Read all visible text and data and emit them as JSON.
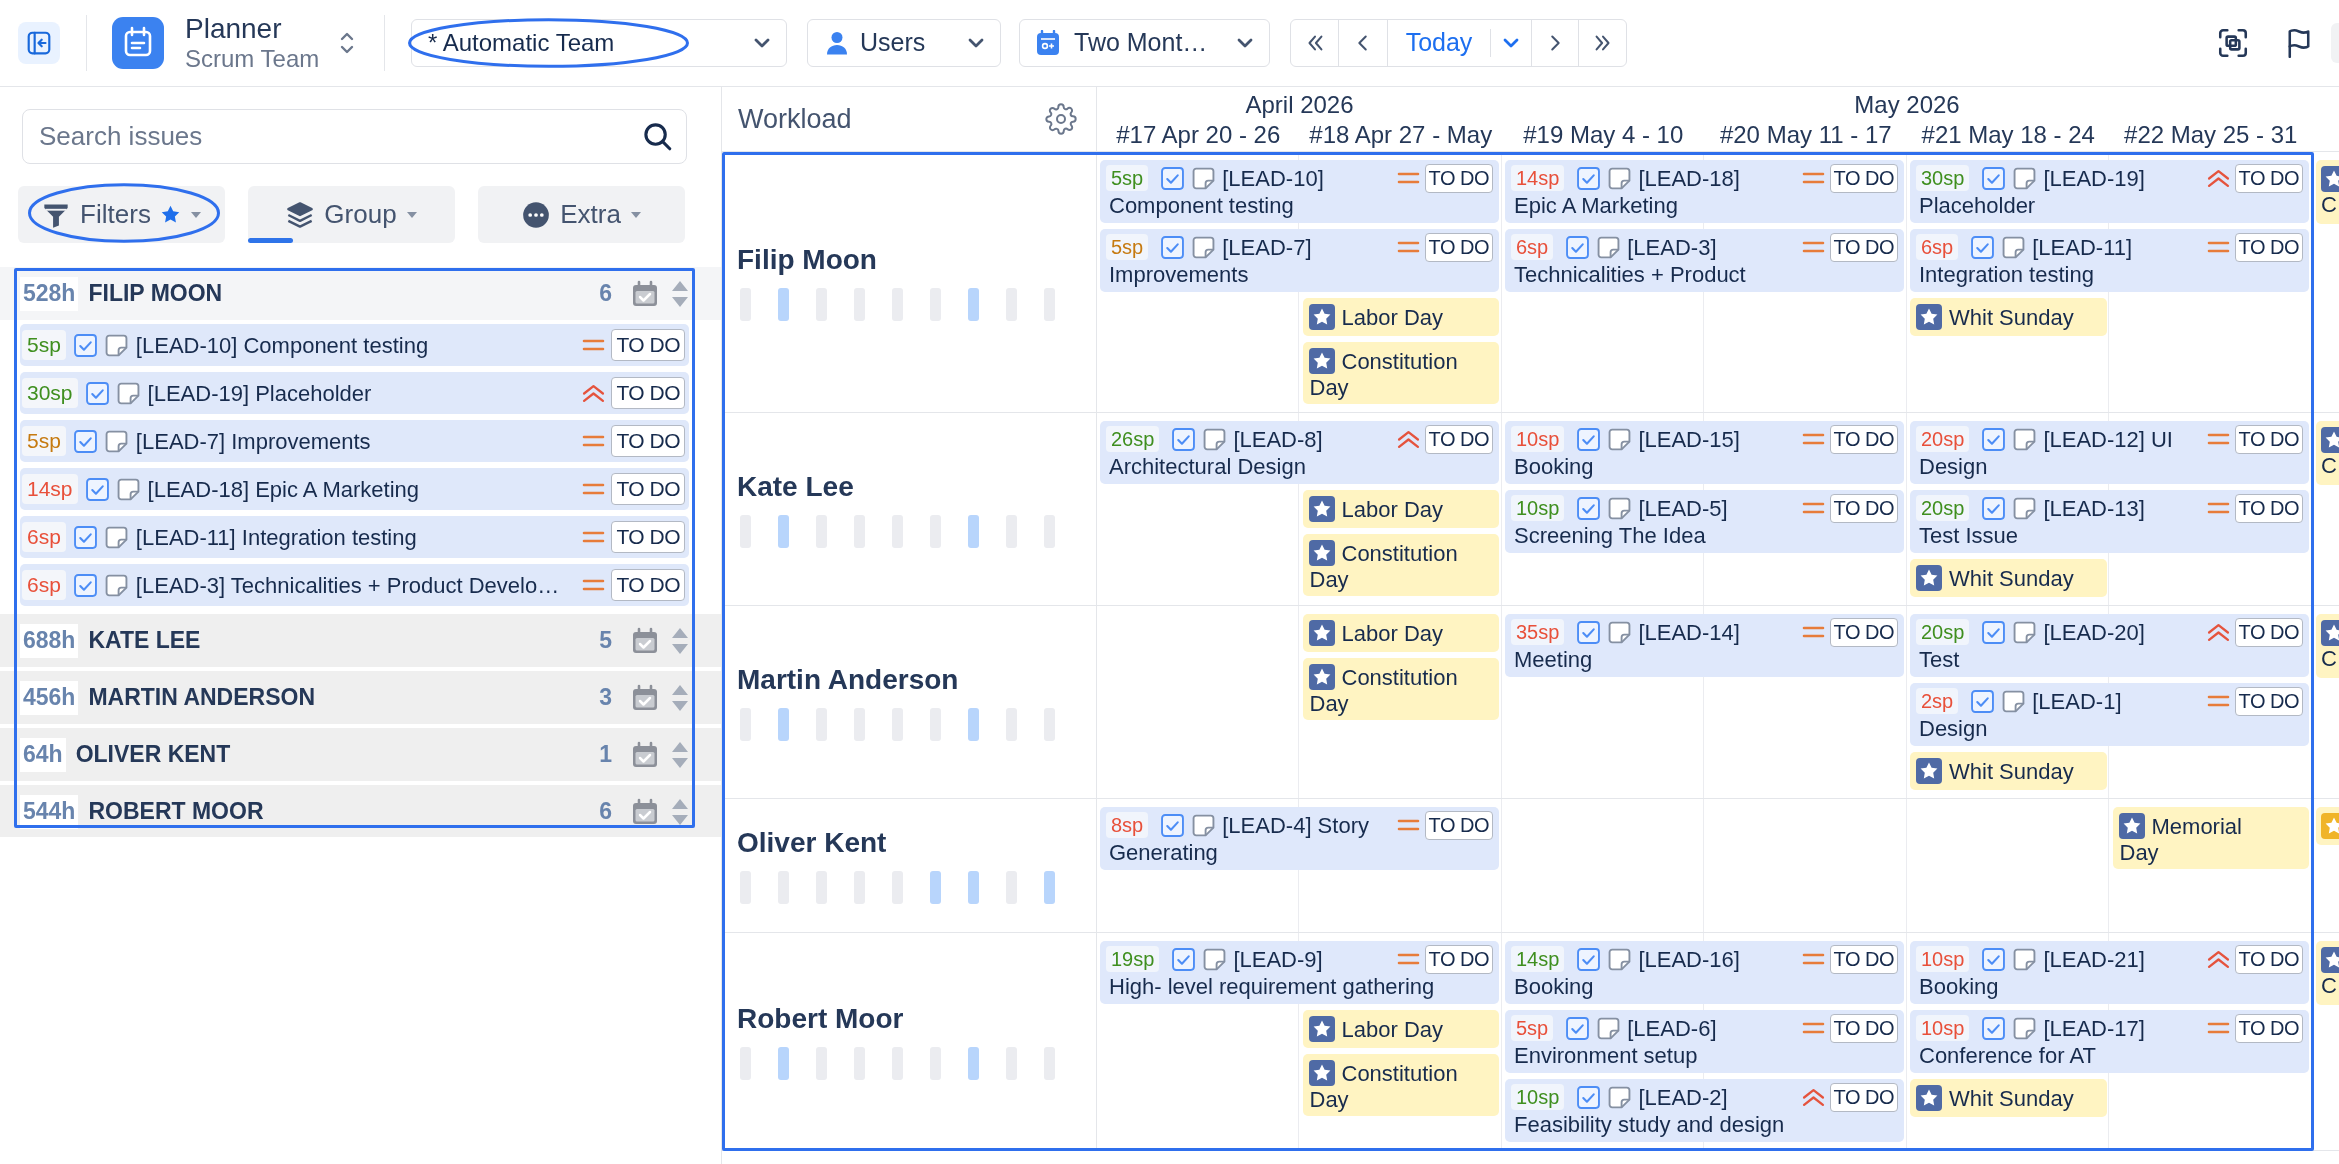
{
  "toolbar": {
    "app": {
      "title": "Planner",
      "subtitle": "Scrum Team"
    },
    "team_select": {
      "value": "* Automatic Team",
      "highlighted": true
    },
    "users_select": {
      "value": "Users"
    },
    "range_select": {
      "value": "Two Mont…"
    },
    "today": "Today"
  },
  "sidebar": {
    "search": {
      "placeholder": "Search issues"
    },
    "tabs": [
      {
        "label": "Filters",
        "selected": false,
        "starred": true,
        "highlighted": true
      },
      {
        "label": "Group",
        "selected": true,
        "starred": false,
        "highlighted": false
      },
      {
        "label": "Extra",
        "selected": false,
        "starred": false,
        "highlighted": false
      }
    ],
    "list": {
      "highlighted": true,
      "groups": [
        {
          "hours": "528h",
          "name": "FILIP MOON",
          "count": "6",
          "issues": [
            {
              "points": "5sp",
              "color": "#3f8f1f",
              "text": "[LEAD-10] Component testing",
              "kind": "medium",
              "status": "TO DO"
            },
            {
              "points": "30sp",
              "color": "#3f8f1f",
              "text": "[LEAD-19] Placeholder",
              "kind": "high",
              "status": "TO DO"
            },
            {
              "points": "5sp",
              "color": "#c67a10",
              "text": "[LEAD-7] Improvements",
              "kind": "medium",
              "status": "TO DO"
            },
            {
              "points": "14sp",
              "color": "#e8503a",
              "text": "[LEAD-18] Epic A Marketing",
              "kind": "medium",
              "status": "TO DO"
            },
            {
              "points": "6sp",
              "color": "#e8503a",
              "text": "[LEAD-11] Integration testing",
              "kind": "medium",
              "status": "TO DO"
            },
            {
              "points": "6sp",
              "color": "#e8503a",
              "text": "[LEAD-3] Technicalities + Product Develo…",
              "kind": "medium",
              "status": "TO DO"
            }
          ]
        },
        {
          "hours": "688h",
          "name": "KATE LEE",
          "count": "5"
        },
        {
          "hours": "456h",
          "name": "MARTIN ANDERSON",
          "count": "3"
        },
        {
          "hours": "64h",
          "name": "OLIVER KENT",
          "count": "1"
        },
        {
          "hours": "544h",
          "name": "ROBERT MOOR",
          "count": "6"
        }
      ]
    }
  },
  "workload": {
    "title": "Workload",
    "highlighted": true,
    "months": [
      {
        "label": "April 2026",
        "weeks": [
          "#17 Apr 20 - 26",
          "#18 Apr 27 - May"
        ]
      },
      {
        "label": "May 2026",
        "weeks": [
          "#19 May 4 - 10",
          "#20 May 11 - 17",
          "#21 May 18 - 24",
          "#22 May 25 - 31"
        ]
      }
    ],
    "people": [
      {
        "name": "Filip Moon",
        "load": [
          {
            "on": false
          },
          {
            "on": true
          },
          {
            "on": false
          },
          {
            "on": false
          },
          {
            "on": false
          },
          {
            "on": false
          },
          {
            "on": true
          },
          {
            "on": false
          },
          {
            "on": false
          }
        ],
        "sprint_1": {
          "issues": [
            {
              "points": "5sp",
              "color": "#3f8f1f",
              "lines": [
                "[LEAD-10]",
                "Component testing"
              ],
              "kind": "medium",
              "status": "TO DO"
            },
            {
              "points": "5sp",
              "color": "#c67a10",
              "lines": [
                "[LEAD-7]",
                "Improvements"
              ],
              "kind": "medium",
              "status": "TO DO"
            }
          ],
          "second_week_holidays": [
            {
              "lines": [
                "Labor Day"
              ],
              "color": "#4f6aa5"
            },
            {
              "lines": [
                "Constitution",
                "Day"
              ],
              "color": "#4f6aa5"
            }
          ]
        },
        "sprint_2": {
          "issues": [
            {
              "points": "14sp",
              "color": "#e8503a",
              "lines": [
                "[LEAD-18]",
                "Epic A Marketing"
              ],
              "kind": "medium",
              "status": "TO DO"
            },
            {
              "points": "6sp",
              "color": "#e8503a",
              "lines": [
                "[LEAD-3]",
                "Technicalities + Product"
              ],
              "kind": "medium",
              "status": "TO DO"
            }
          ]
        },
        "sprint_3": {
          "issues": [
            {
              "points": "30sp",
              "color": "#3f8f1f",
              "lines": [
                "[LEAD-19]",
                "Placeholder"
              ],
              "kind": "high",
              "status": "TO DO"
            },
            {
              "points": "6sp",
              "color": "#e8503a",
              "lines": [
                "[LEAD-11]",
                "Integration testing"
              ],
              "kind": "medium",
              "status": "TO DO"
            }
          ],
          "first_week_holidays": [
            {
              "lines": [
                "Whit Sunday"
              ],
              "color": "#4f6aa5"
            }
          ]
        },
        "cut_off": [
          {
            "text": "C",
            "color": "#4f6aa5"
          }
        ]
      },
      {
        "name": "Kate Lee",
        "load": [
          {
            "on": false
          },
          {
            "on": true
          },
          {
            "on": false
          },
          {
            "on": false
          },
          {
            "on": false
          },
          {
            "on": false
          },
          {
            "on": true
          },
          {
            "on": false
          },
          {
            "on": false
          }
        ],
        "sprint_1": {
          "issues": [
            {
              "points": "26sp",
              "color": "#3f8f1f",
              "lines": [
                "[LEAD-8]",
                "Architectural Design"
              ],
              "kind": "high",
              "status": "TO DO"
            }
          ],
          "second_week_holidays": [
            {
              "lines": [
                "Labor Day"
              ],
              "color": "#4f6aa5"
            },
            {
              "lines": [
                "Constitution",
                "Day"
              ],
              "color": "#4f6aa5"
            }
          ]
        },
        "sprint_2": {
          "issues": [
            {
              "points": "10sp",
              "color": "#e8503a",
              "lines": [
                "[LEAD-15]",
                "Booking"
              ],
              "kind": "medium",
              "status": "TO DO"
            },
            {
              "points": "10sp",
              "color": "#3f8f1f",
              "lines": [
                "[LEAD-5]",
                "Screening The Idea"
              ],
              "kind": "medium",
              "status": "TO DO"
            }
          ]
        },
        "sprint_3": {
          "issues": [
            {
              "points": "20sp",
              "color": "#e8503a",
              "lines": [
                "[LEAD-12] UI",
                "Design"
              ],
              "kind": "medium",
              "status": "TO DO"
            },
            {
              "points": "20sp",
              "color": "#3f8f1f",
              "lines": [
                "[LEAD-13]",
                "Test Issue"
              ],
              "kind": "medium",
              "status": "TO DO"
            }
          ],
          "first_week_holidays": [
            {
              "lines": [
                "Whit Sunday"
              ],
              "color": "#4f6aa5"
            }
          ]
        },
        "cut_off": [
          {
            "text": "C",
            "color": "#4f6aa5"
          }
        ]
      },
      {
        "name": "Martin Anderson",
        "load": [
          {
            "on": false
          },
          {
            "on": true
          },
          {
            "on": false
          },
          {
            "on": false
          },
          {
            "on": false
          },
          {
            "on": false
          },
          {
            "on": true
          },
          {
            "on": false
          },
          {
            "on": false
          }
        ],
        "sprint_1": {
          "second_week_holidays": [
            {
              "lines": [
                "Labor Day"
              ],
              "color": "#4f6aa5"
            },
            {
              "lines": [
                "Constitution",
                "Day"
              ],
              "color": "#4f6aa5"
            }
          ]
        },
        "sprint_2": {
          "issues": [
            {
              "points": "35sp",
              "color": "#e8503a",
              "lines": [
                "[LEAD-14]",
                "Meeting"
              ],
              "kind": "medium",
              "status": "TO DO"
            }
          ]
        },
        "sprint_3": {
          "issues": [
            {
              "points": "20sp",
              "color": "#3f8f1f",
              "lines": [
                "[LEAD-20]",
                "Test"
              ],
              "kind": "high",
              "status": "TO DO"
            },
            {
              "points": "2sp",
              "color": "#e8503a",
              "lines": [
                "[LEAD-1]",
                "Design"
              ],
              "kind": "medium",
              "status": "TO DO"
            }
          ],
          "first_week_holidays": [
            {
              "lines": [
                "Whit Sunday"
              ],
              "color": "#4f6aa5"
            }
          ]
        },
        "cut_off": [
          {
            "text": "C",
            "color": "#4f6aa5"
          }
        ]
      },
      {
        "name": "Oliver Kent",
        "load": [
          {
            "on": false
          },
          {
            "on": false
          },
          {
            "on": false
          },
          {
            "on": false
          },
          {
            "on": false
          },
          {
            "on": true
          },
          {
            "on": true
          },
          {
            "on": false
          },
          {
            "on": true
          }
        ],
        "sprint_1": {
          "issues": [
            {
              "points": "8sp",
              "color": "#e8503a",
              "lines": [
                "[LEAD-4] Story",
                "Generating"
              ],
              "kind": "medium",
              "status": "TO DO"
            }
          ]
        },
        "sprint_3": {
          "second_week_holidays": [
            {
              "lines": [
                "Memorial",
                "Day"
              ],
              "color": "#4f6aa5"
            }
          ]
        },
        "cut_off": [
          {
            "color": "#f0b429"
          }
        ]
      },
      {
        "name": "Robert Moor",
        "load": [
          {
            "on": false
          },
          {
            "on": true
          },
          {
            "on": false
          },
          {
            "on": false
          },
          {
            "on": false
          },
          {
            "on": false
          },
          {
            "on": true
          },
          {
            "on": false
          },
          {
            "on": false
          }
        ],
        "sprint_1": {
          "issues": [
            {
              "points": "19sp",
              "color": "#3f8f1f",
              "lines": [
                "[LEAD-9]",
                "High- level requirement gathering"
              ],
              "kind": "medium",
              "status": "TO DO"
            }
          ],
          "second_week_holidays": [
            {
              "lines": [
                "Labor Day"
              ],
              "color": "#4f6aa5"
            },
            {
              "lines": [
                "Constitution",
                "Day"
              ],
              "color": "#4f6aa5"
            }
          ]
        },
        "sprint_2": {
          "issues": [
            {
              "points": "14sp",
              "color": "#3f8f1f",
              "lines": [
                "[LEAD-16]",
                "Booking"
              ],
              "kind": "medium",
              "status": "TO DO"
            },
            {
              "points": "5sp",
              "color": "#e8503a",
              "lines": [
                "[LEAD-6]",
                "Environment setup"
              ],
              "kind": "medium",
              "status": "TO DO"
            },
            {
              "points": "10sp",
              "color": "#3f8f1f",
              "lines": [
                "[LEAD-2]",
                "Feasibility study and design"
              ],
              "kind": "high",
              "status": "TO DO"
            }
          ]
        },
        "sprint_3": {
          "issues": [
            {
              "points": "10sp",
              "color": "#e8503a",
              "lines": [
                "[LEAD-21]",
                "Booking"
              ],
              "kind": "high",
              "status": "TO DO"
            },
            {
              "points": "10sp",
              "color": "#e8503a",
              "lines": [
                "[LEAD-17]",
                "Conference for AT"
              ],
              "kind": "medium",
              "status": "TO DO"
            }
          ],
          "first_week_holidays": [
            {
              "lines": [
                "Whit Sunday"
              ],
              "color": "#4f6aa5"
            }
          ]
        },
        "cut_off": [
          {
            "text": "C",
            "color": "#4f6aa5"
          }
        ]
      }
    ]
  }
}
